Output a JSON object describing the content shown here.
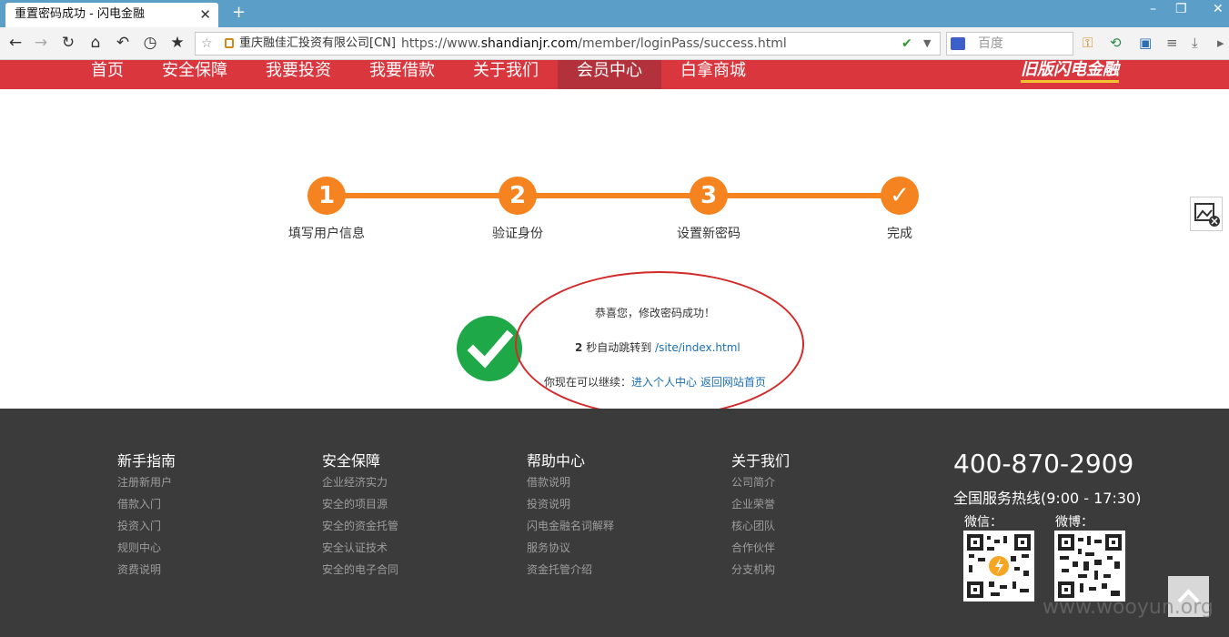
{
  "browser": {
    "tab_title": "重置密码成功 - 闪电金融",
    "tab_close": "✕",
    "new_tab": "+",
    "site_identity": "重庆融佳汇投资有限公司[CN]",
    "url_prefix": "https://www.",
    "url_domain": "shandianjr.com",
    "url_path": "/member/loginPass/success.html",
    "search_placeholder": "百度",
    "win_min": "–",
    "win_max": "❐",
    "win_close": "✕"
  },
  "nav": {
    "items": [
      "首页",
      "安全保障",
      "我要投资",
      "我要借款",
      "关于我们",
      "会员中心",
      "白拿商城"
    ],
    "old_version": "旧版闪电金融"
  },
  "steps": [
    {
      "num": "1",
      "label": "填写用户信息"
    },
    {
      "num": "2",
      "label": "验证身份"
    },
    {
      "num": "3",
      "label": "设置新密码"
    },
    {
      "num": "✓",
      "label": "完成"
    }
  ],
  "success": {
    "message": "恭喜您，修改密码成功！",
    "countdown": "2",
    "redirect_text": "秒自动跳转到",
    "redirect_link": "/site/index.html",
    "continue_text": "你现在可以继续：",
    "link_personal": "进入个人中心",
    "link_home": "返回网站首页"
  },
  "footer": {
    "columns": [
      {
        "title": "新手指南",
        "items": [
          "注册新用户",
          "借款入门",
          "投资入门",
          "规则中心",
          "资费说明"
        ]
      },
      {
        "title": "安全保障",
        "items": [
          "企业经济实力",
          "安全的项目源",
          "安全的资金托管",
          "安全认证技术",
          "安全的电子合同"
        ]
      },
      {
        "title": "帮助中心",
        "items": [
          "借款说明",
          "投资说明",
          "闪电金融名词解释",
          "服务协议",
          "资金托管介绍"
        ]
      },
      {
        "title": "关于我们",
        "items": [
          "公司简介",
          "企业荣誉",
          "核心团队",
          "合作伙伴",
          "分支机构"
        ]
      }
    ],
    "phone": "400-870-2909",
    "hotline": "全国服务热线(9:00 - 17:30)",
    "wechat_label": "微信：",
    "weibo_label": "微博：",
    "watermark": "www.wooyun.org"
  },
  "colors": {
    "nav_red": "#d9363e",
    "step_orange": "#f5831f",
    "success_green": "#1fa848",
    "footer_bg": "#3b3b3b"
  }
}
